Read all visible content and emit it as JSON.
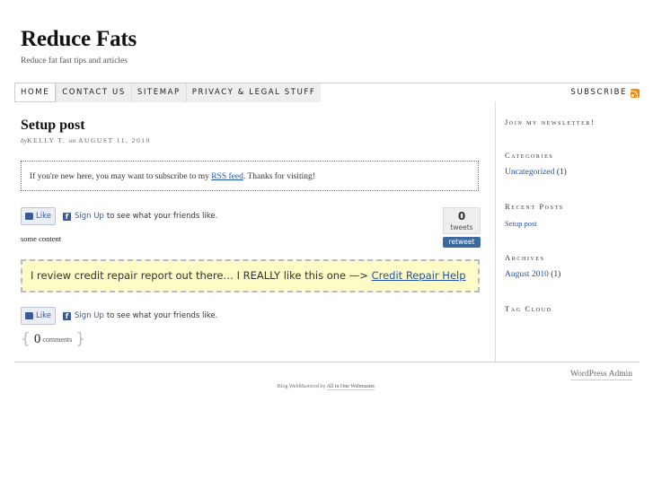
{
  "site": {
    "title": "Reduce Fats",
    "tagline": "Reduce fat fast tips and articles"
  },
  "nav": {
    "items": [
      {
        "label": "HOME"
      },
      {
        "label": "CONTACT US"
      },
      {
        "label": "SITEMAP"
      },
      {
        "label": "PRIVACY & LEGAL STUFF"
      }
    ],
    "subscribe_label": "SUBSCRIBE"
  },
  "post": {
    "title": "Setup post",
    "by_word": "by",
    "author": "KELLY T.",
    "on_word": "on",
    "date": "AUGUST 11, 2010",
    "notice_prefix": "If you're new here, you may want to subscribe to my ",
    "notice_link": "RSS feed",
    "notice_suffix": ". Thanks for visiting!",
    "content": "some content",
    "highlight_text": "I review credit repair report out there… I REALLY like this one —> ",
    "highlight_link": "Credit Repair Help",
    "comments_count": "0",
    "comments_label": "comments"
  },
  "facebook": {
    "like_label": "Like",
    "signup_label": "Sign Up",
    "suffix": "to see what your friends like."
  },
  "tweetmeme": {
    "count": "0",
    "label": "tweets",
    "button": "retweet"
  },
  "sidebar": {
    "newsletter_title": "Join my newsletter!",
    "categories_title": "Categories",
    "category": {
      "label": "Uncategorized",
      "count": "(1)"
    },
    "recent_title": "Recent Posts",
    "recent_post": "Setup post",
    "archives_title": "Archives",
    "archive": {
      "label": "August 2010",
      "count": "(1)"
    },
    "tagcloud_title": "Tag Cloud"
  },
  "footer": {
    "admin_label": "WordPress Admin",
    "credit_prefix": "Blog WebMastered by ",
    "credit_link": "All in One Webmaster",
    "credit_suffix": "."
  },
  "colors": {
    "link": "#2255aa",
    "facebook": "#3b5998",
    "highlight_bg": "#fdfcc6",
    "rss": "#f48a12"
  }
}
